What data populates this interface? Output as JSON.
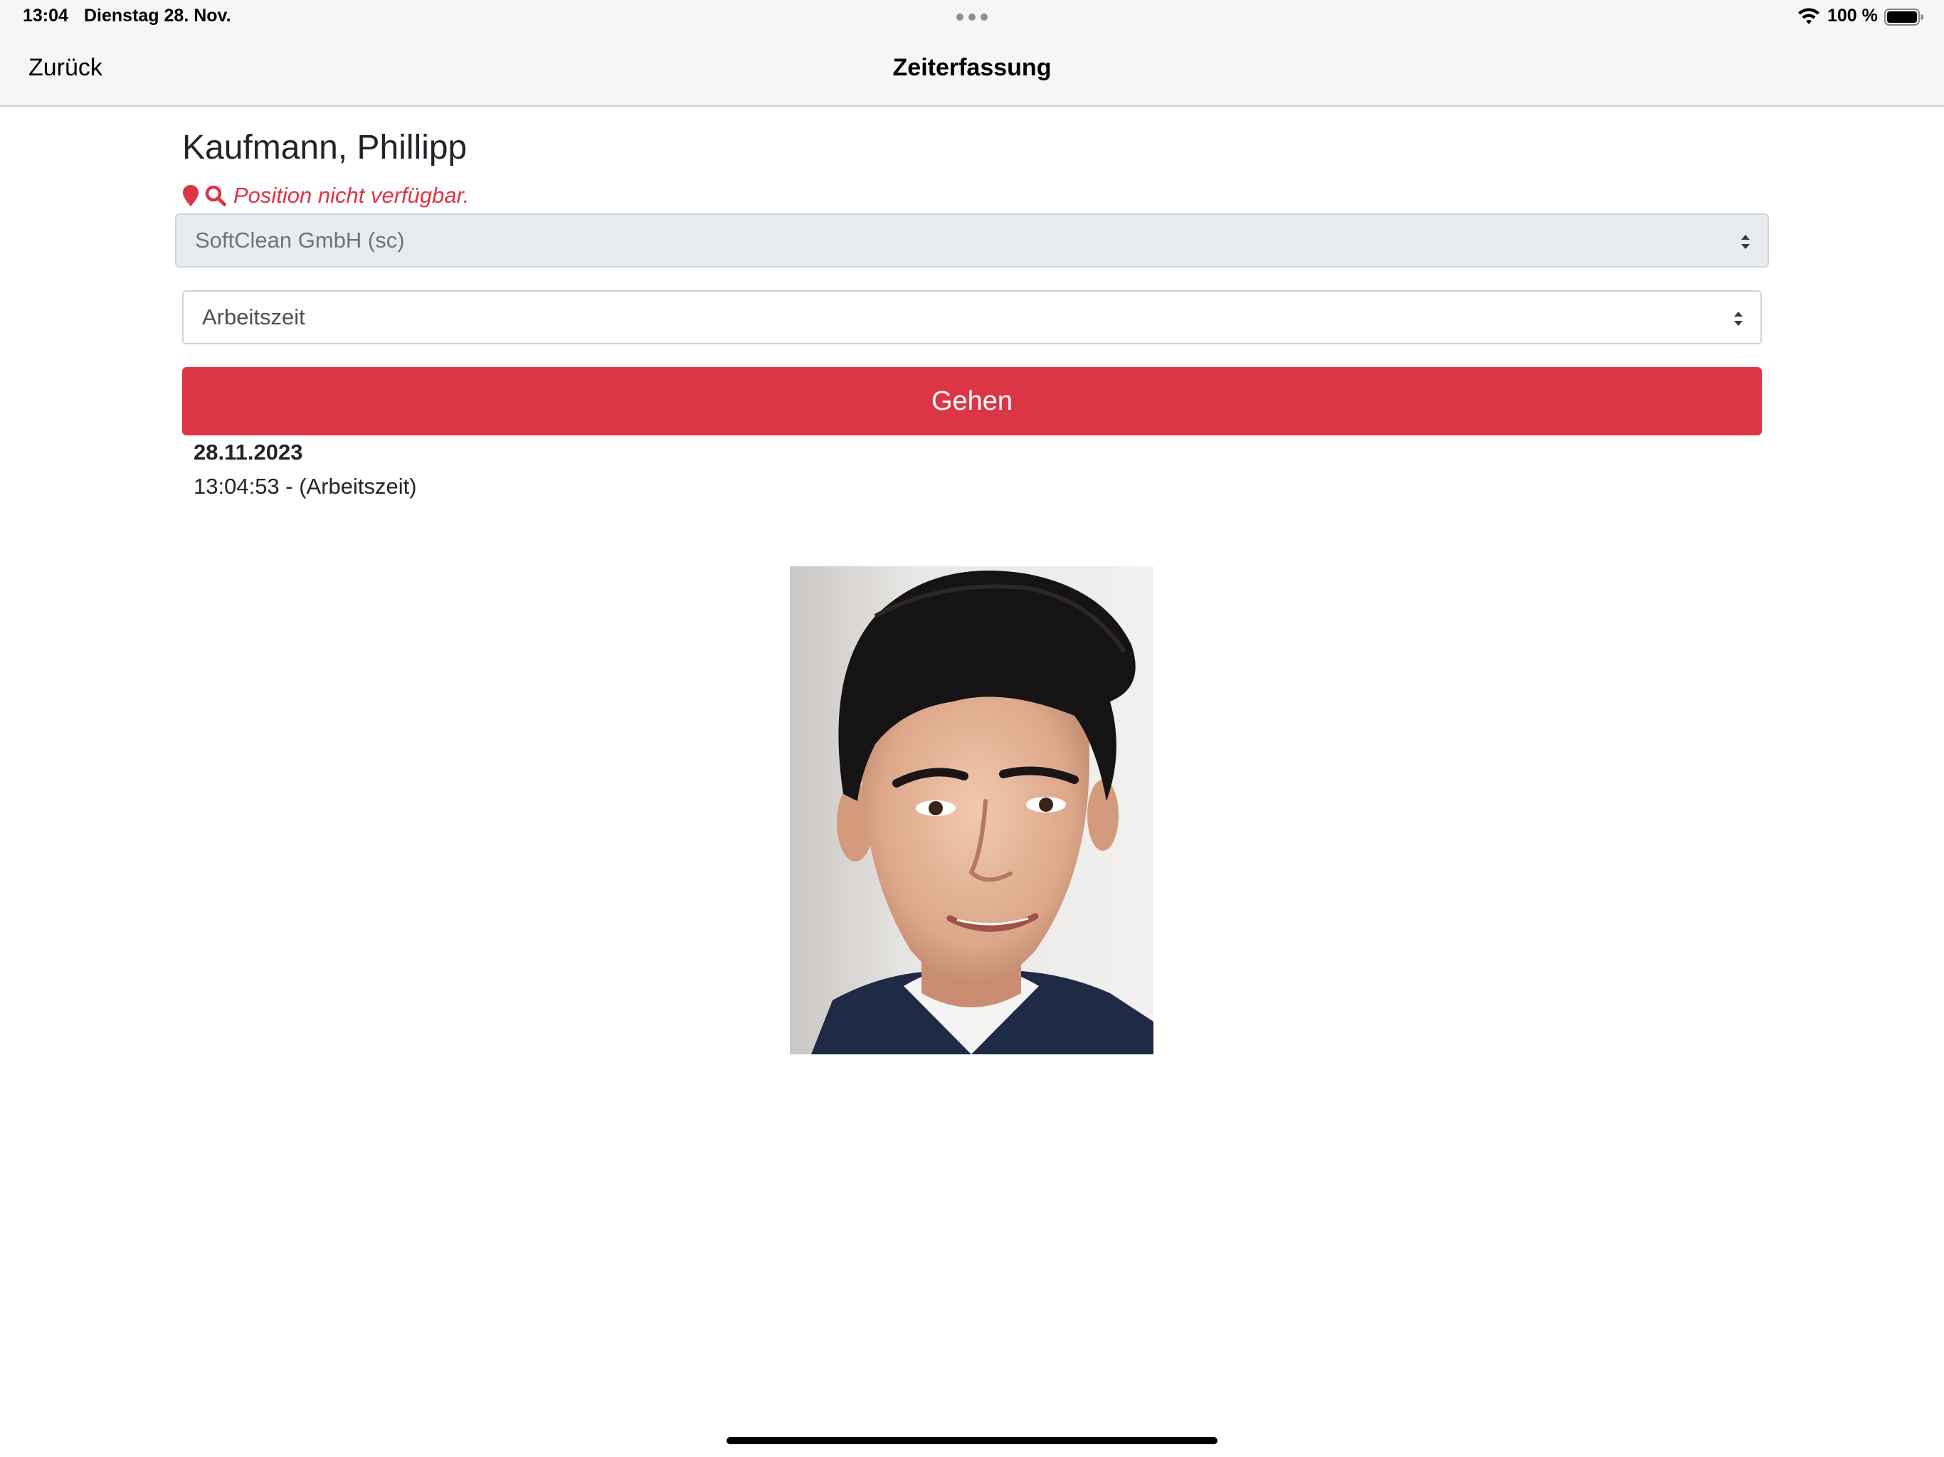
{
  "status": {
    "time": "13:04",
    "date": "Dienstag 28. Nov.",
    "battery": "100 %"
  },
  "nav": {
    "back_label": "Zurück",
    "title": "Zeiterfassung"
  },
  "employee": {
    "name": "Kaufmann, Phillipp"
  },
  "location": {
    "message": "Position nicht verfügbar."
  },
  "company_select": {
    "value": "SoftClean GmbH (sc)"
  },
  "type_select": {
    "value": "Arbeitszeit"
  },
  "action": {
    "label": "Gehen"
  },
  "entries": {
    "date": "28.11.2023",
    "line": "13:04:53 - (Arbeitszeit)"
  },
  "colors": {
    "accent_red": "#dc3545",
    "bar_bg": "#f6f6f6"
  }
}
